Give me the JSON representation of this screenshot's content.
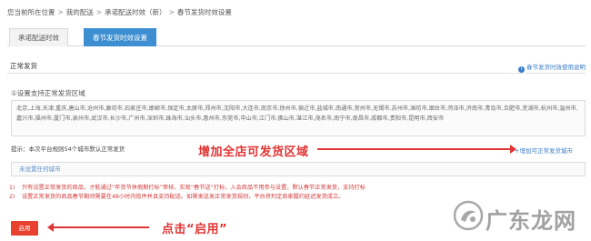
{
  "breadcrumb": {
    "prefix": "您当前所在位置",
    "items": [
      "我的配送",
      "承诺配送时效（新）",
      "春节发货时效设置"
    ],
    "separator": ">"
  },
  "tabs": [
    {
      "label": "承诺配送时效",
      "active": false
    },
    {
      "label": "春节发货时效设置",
      "active": true
    }
  ],
  "section": {
    "title": "正常发货",
    "help_link": "春节发货时效使用说明",
    "help_icon": "info-icon"
  },
  "step": {
    "title": "①设置支持正常发货区域"
  },
  "cities_text": "北京,上海,天津,重庆,唐山市,沧州市,廊坊市,石家庄市,邯郸市,保定市,太原市,郑州市,沈阳市,大连市,南京市,徐州市,宿迁市,盐城市,南通市,常州市,无锡市,苏州市,潍坊市,烟台市,菏泽市,济南市,青岛市,合肥市,芜湖市,杭州市,温州市,嘉兴市,福州市,厦门市,泉州市,武汉市,长沙市,广州市,深圳市,珠海市,汕头市,惠州市,东莞市,中山市,江门市,佛山市,湛江市,茂名市,南宁市,南昌市,成都市,贵阳市,昆明市,西安市",
  "tip": "提示：本次平台规则54个城市默认正常发货",
  "annotations": {
    "add_area": "增加全店可发货区域",
    "click_enable": "点击“启用”"
  },
  "add_area_link": "+增加可正常发货城市",
  "unset_bar": "未设置任何城市",
  "notes": [
    {
      "num": "1)",
      "text": "只有设置正常发货的商品，才能通过“年货节休假期打标”审核，实现“春节送”打标，入会商品不用参与设置，默认春节正常发货，支持打标"
    },
    {
      "num": "2)",
      "text": "设置正常发货的商品春节期间需要在48小时内揽件并且支持配送。如需发送发正常发货规则，平台将判定商家履约延迟发货成立。"
    }
  ],
  "enable_button": "启用",
  "watermark": {
    "text": "广东龙网"
  },
  "colors": {
    "accent_blue": "#3d8fd1",
    "annotation_red": "#e03434",
    "button_red": "#e8412f",
    "link_blue": "#3a7bc8"
  }
}
